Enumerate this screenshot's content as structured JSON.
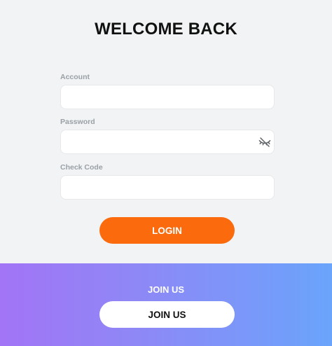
{
  "login": {
    "title": "WELCOME BACK",
    "account": {
      "label": "Account",
      "value": "",
      "placeholder": ""
    },
    "password": {
      "label": "Password",
      "value": "",
      "placeholder": "",
      "toggle_icon": "eye-off-icon"
    },
    "check_code": {
      "label": "Check Code",
      "value": "",
      "placeholder": ""
    },
    "login_button": "LOGIN"
  },
  "join": {
    "heading": "JOIN US",
    "button": "JOIN US"
  },
  "colors": {
    "login_panel_bg": "#f1f3f4",
    "accent_orange": "#fb6a0c",
    "gradient_start": "#a274f6",
    "gradient_end": "#6aa4fb"
  }
}
